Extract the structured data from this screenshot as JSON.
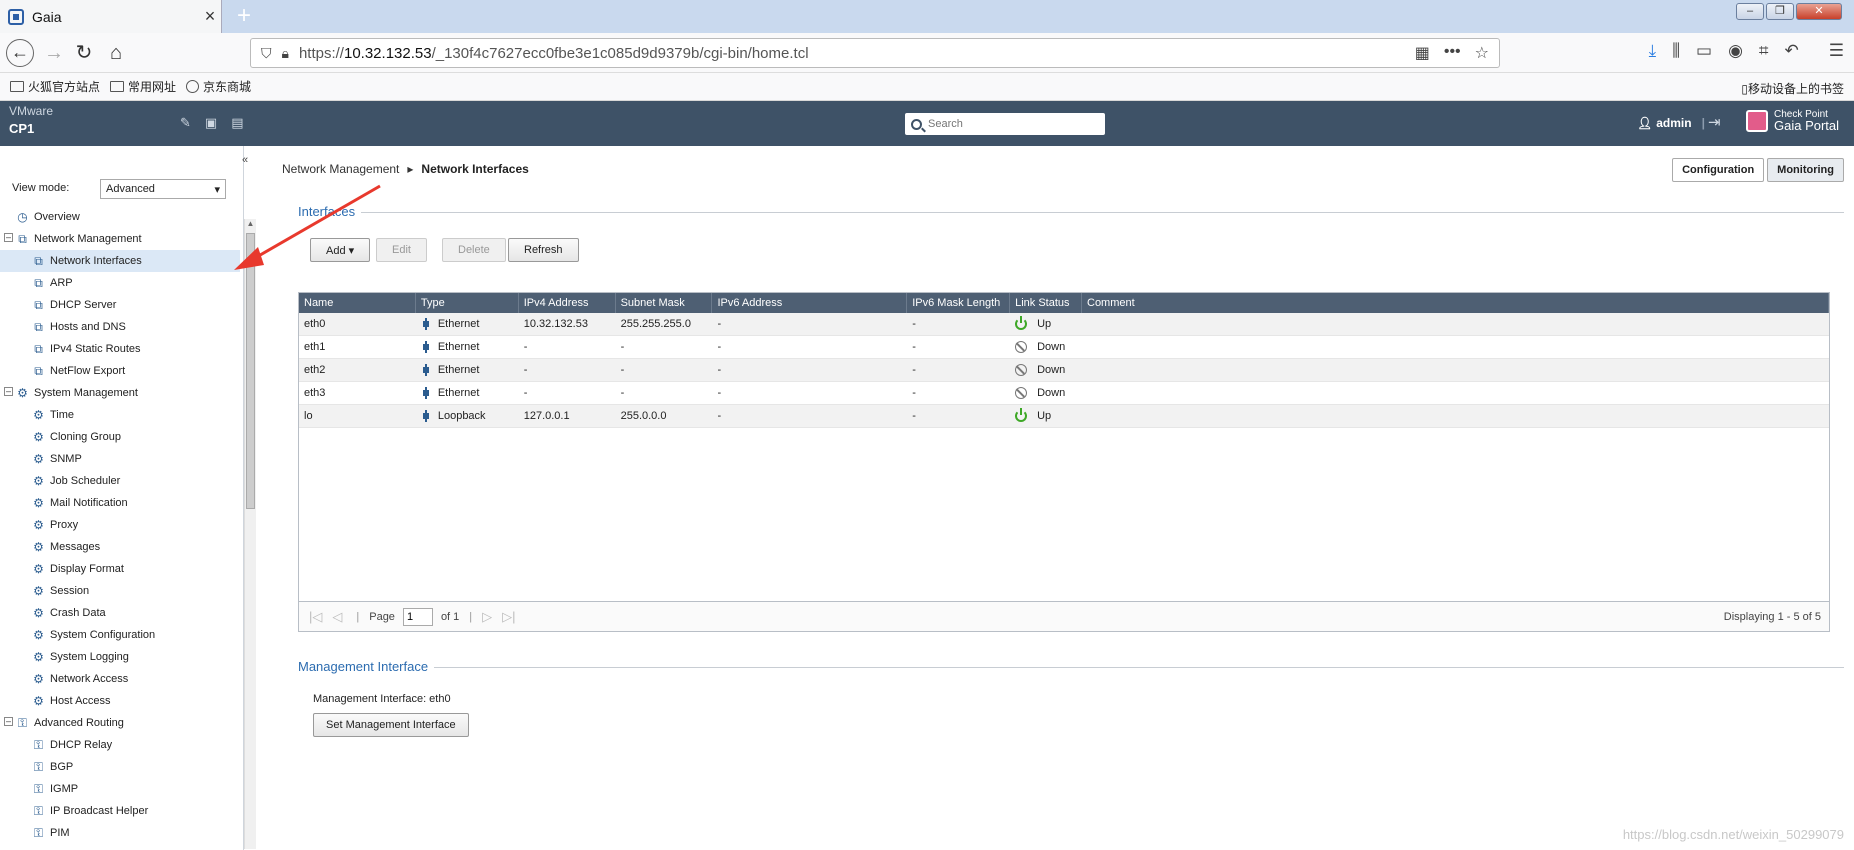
{
  "browser": {
    "tab_title": "Gaia",
    "url_prefix": "https://",
    "url_host": "10.32.132.53",
    "url_path": "/_130f4c7627ecc0fbe3e1c085d9d9379b/cgi-bin/home.tcl",
    "bookmarks": [
      "火狐官方站点",
      "常用网址",
      "京东商城"
    ],
    "mobile_bookmarks": "移动设备上的书签"
  },
  "header": {
    "vendor": "VMware",
    "host": "CP1",
    "search_placeholder": "Search",
    "user": "admin",
    "logo_line1": "Check Point",
    "logo_line2": "Gaia Portal"
  },
  "sidebar": {
    "view_mode_label": "View mode:",
    "view_mode_value": "Advanced",
    "items": [
      {
        "label": "Overview",
        "level": 1,
        "icon": "overview-icon"
      },
      {
        "label": "Network Management",
        "level": 0,
        "icon": "network-icon",
        "expander": "⊟"
      },
      {
        "label": "Network Interfaces",
        "level": 2,
        "icon": "network-icon",
        "selected": true
      },
      {
        "label": "ARP",
        "level": 2,
        "icon": "network-icon"
      },
      {
        "label": "DHCP Server",
        "level": 2,
        "icon": "network-icon"
      },
      {
        "label": "Hosts and DNS",
        "level": 2,
        "icon": "network-icon"
      },
      {
        "label": "IPv4 Static Routes",
        "level": 2,
        "icon": "network-icon"
      },
      {
        "label": "NetFlow Export",
        "level": 2,
        "icon": "network-icon"
      },
      {
        "label": "System Management",
        "level": 0,
        "icon": "gear-icon",
        "expander": "⊟"
      },
      {
        "label": "Time",
        "level": 2,
        "icon": "gear-icon"
      },
      {
        "label": "Cloning Group",
        "level": 2,
        "icon": "gear-icon"
      },
      {
        "label": "SNMP",
        "level": 2,
        "icon": "gear-icon"
      },
      {
        "label": "Job Scheduler",
        "level": 2,
        "icon": "gear-icon"
      },
      {
        "label": "Mail Notification",
        "level": 2,
        "icon": "gear-icon"
      },
      {
        "label": "Proxy",
        "level": 2,
        "icon": "gear-icon"
      },
      {
        "label": "Messages",
        "level": 2,
        "icon": "gear-icon"
      },
      {
        "label": "Display Format",
        "level": 2,
        "icon": "gear-icon"
      },
      {
        "label": "Session",
        "level": 2,
        "icon": "gear-icon"
      },
      {
        "label": "Crash Data",
        "level": 2,
        "icon": "gear-icon"
      },
      {
        "label": "System Configuration",
        "level": 2,
        "icon": "gear-icon"
      },
      {
        "label": "System Logging",
        "level": 2,
        "icon": "gear-icon"
      },
      {
        "label": "Network Access",
        "level": 2,
        "icon": "gear-icon"
      },
      {
        "label": "Host Access",
        "level": 2,
        "icon": "gear-icon"
      },
      {
        "label": "Advanced Routing",
        "level": 0,
        "icon": "routing-icon",
        "expander": "⊟"
      },
      {
        "label": "DHCP Relay",
        "level": 2,
        "icon": "routing-icon"
      },
      {
        "label": "BGP",
        "level": 2,
        "icon": "routing-icon"
      },
      {
        "label": "IGMP",
        "level": 2,
        "icon": "routing-icon"
      },
      {
        "label": "IP Broadcast Helper",
        "level": 2,
        "icon": "routing-icon"
      },
      {
        "label": "PIM",
        "level": 2,
        "icon": "routing-icon"
      }
    ]
  },
  "main": {
    "breadcrumb_parent": "Network Management",
    "breadcrumb_current": "Network Interfaces",
    "tab_configuration": "Configuration",
    "tab_monitoring": "Monitoring",
    "interfaces_title": "Interfaces",
    "btn_add": "Add ▾",
    "btn_edit": "Edit",
    "btn_delete": "Delete",
    "btn_refresh": "Refresh",
    "columns": [
      "Name",
      "Type",
      "IPv4 Address",
      "Subnet Mask",
      "IPv6 Address",
      "IPv6 Mask Length",
      "Link Status",
      "Comment"
    ],
    "rows": [
      {
        "name": "eth0",
        "type": "Ethernet",
        "ipv4": "10.32.132.53",
        "mask": "255.255.255.0",
        "ipv6": "-",
        "ipv6len": "-",
        "status": "Up",
        "comment": ""
      },
      {
        "name": "eth1",
        "type": "Ethernet",
        "ipv4": "-",
        "mask": "-",
        "ipv6": "-",
        "ipv6len": "-",
        "status": "Down",
        "comment": ""
      },
      {
        "name": "eth2",
        "type": "Ethernet",
        "ipv4": "-",
        "mask": "-",
        "ipv6": "-",
        "ipv6len": "-",
        "status": "Down",
        "comment": ""
      },
      {
        "name": "eth3",
        "type": "Ethernet",
        "ipv4": "-",
        "mask": "-",
        "ipv6": "-",
        "ipv6len": "-",
        "status": "Down",
        "comment": ""
      },
      {
        "name": "lo",
        "type": "Loopback",
        "ipv4": "127.0.0.1",
        "mask": "255.0.0.0",
        "ipv6": "-",
        "ipv6len": "-",
        "status": "Up",
        "comment": ""
      }
    ],
    "pager_page_label": "Page",
    "pager_page_value": "1",
    "pager_of": "of 1",
    "pager_display": "Displaying 1 - 5 of 5",
    "mgmt_title": "Management Interface",
    "mgmt_text": "Management Interface: eth0",
    "mgmt_button": "Set Management Interface"
  },
  "watermark": "https://blog.csdn.net/weixin_50299079",
  "colors": {
    "header_bg": "#3e5267",
    "grid_header": "#4e5f73",
    "link_blue": "#2c6cb0",
    "up_green": "#3ea827",
    "arrow_red": "#e8392d"
  }
}
